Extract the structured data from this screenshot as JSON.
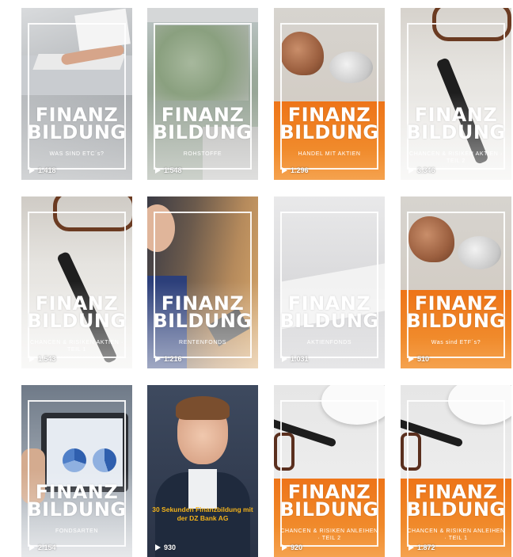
{
  "brand_line1": "FINANZ",
  "brand_line2": "BILDUNG",
  "play_icon": "play-icon",
  "colors": {
    "orange": "#ee7418",
    "yellow_text": "#f2b21b",
    "frame": "#ffffff"
  },
  "tiles": [
    {
      "caption": "WAS SIND ETC´s?",
      "views": "1.418"
    },
    {
      "caption": "ROHSTOFFE",
      "views": "1.548"
    },
    {
      "caption": "HANDEL MIT AKTIEN",
      "views": "1.296"
    },
    {
      "caption": "CHANCEN & RISIKEN AKTIEN · TEIL 2",
      "views": "3.346"
    },
    {
      "caption": "CHANCEN & RISIKEN AKTIEN · TEIL 1",
      "views": "1.543"
    },
    {
      "caption": "RENTENFONDS",
      "views": "1.216"
    },
    {
      "caption": "AKTIENFONDS",
      "views": "1.031"
    },
    {
      "caption": "Was sind ETF´s?",
      "views": "510"
    },
    {
      "caption": "FONDSARTEN",
      "views": "2.154"
    },
    {
      "caption": "30 Sekunden Finanzbildung mit der DZ Bank AG",
      "views": "930"
    },
    {
      "caption": "CHANCEN & RISIKEN ANLEIHEN · TEIL 2",
      "views": "920"
    },
    {
      "caption": "CHANCEN & RISIKEN ANLEIHEN · TEIL 1",
      "views": "1.872"
    }
  ]
}
